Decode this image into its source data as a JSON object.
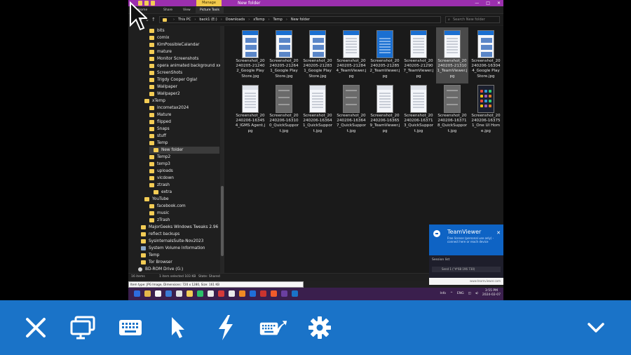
{
  "explorer": {
    "title_bar": {
      "manage_tab": "Manage",
      "window_title": "New folder",
      "controls": [
        "—",
        "□",
        "✕"
      ]
    },
    "ribbon_tabs": [
      {
        "label": "Home",
        "active": false
      },
      {
        "label": "Share",
        "active": false
      },
      {
        "label": "View",
        "active": false
      },
      {
        "label": "Picture Tools",
        "active": true
      }
    ],
    "address": {
      "breadcrumbs": [
        "This PC",
        "back1 (E:)",
        "Downloads",
        "xTemp",
        "Temp",
        "New folder"
      ],
      "search_placeholder": "Search New folder"
    },
    "nav_items": [
      {
        "label": "bits",
        "indent": 1,
        "kind": "folder"
      },
      {
        "label": "comix",
        "indent": 1,
        "kind": "folder"
      },
      {
        "label": "KimPossibleCalandar",
        "indent": 1,
        "kind": "folder"
      },
      {
        "label": "mature",
        "indent": 1,
        "kind": "folder"
      },
      {
        "label": "Monitor Screenshots",
        "indent": 1,
        "kind": "folder"
      },
      {
        "label": "opera animated background xxx",
        "indent": 1,
        "kind": "folder"
      },
      {
        "label": "ScreenShots",
        "indent": 1,
        "kind": "folder"
      },
      {
        "label": "Trigdy Cooper   Ogla!",
        "indent": 1,
        "kind": "folder"
      },
      {
        "label": "Wallpaper",
        "indent": 1,
        "kind": "folder"
      },
      {
        "label": "Wallpaper2",
        "indent": 1,
        "kind": "folder"
      },
      {
        "label": "xTemp",
        "indent": 0,
        "kind": "folder"
      },
      {
        "label": "incometax2024",
        "indent": 2,
        "kind": "folder"
      },
      {
        "label": "Mature",
        "indent": 2,
        "kind": "folder"
      },
      {
        "label": "flipped",
        "indent": 2,
        "kind": "folder"
      },
      {
        "label": "Snaps",
        "indent": 2,
        "kind": "folder"
      },
      {
        "label": "stuff",
        "indent": 2,
        "kind": "folder"
      },
      {
        "label": "Temp",
        "indent": 2,
        "kind": "folder"
      },
      {
        "label": "New folder",
        "indent": 3,
        "kind": "folder",
        "selected": true
      },
      {
        "label": "Temp2",
        "indent": 2,
        "kind": "folder"
      },
      {
        "label": "temp3",
        "indent": 2,
        "kind": "folder"
      },
      {
        "label": "uploads",
        "indent": 2,
        "kind": "folder"
      },
      {
        "label": "vlcdown",
        "indent": 2,
        "kind": "folder"
      },
      {
        "label": "ztrash",
        "indent": 2,
        "kind": "folder"
      },
      {
        "label": "extra",
        "indent": 3,
        "kind": "folder"
      },
      {
        "label": "YouTube",
        "indent": 0,
        "kind": "folder"
      },
      {
        "label": "facebook.com",
        "indent": 2,
        "kind": "folder"
      },
      {
        "label": "music",
        "indent": 2,
        "kind": "folder"
      },
      {
        "label": "zTrash",
        "indent": 2,
        "kind": "folder"
      },
      {
        "label": "MajorGeeks Windows Tweaks 2.96",
        "indent": -1,
        "kind": "folder"
      },
      {
        "label": "reflect backups",
        "indent": -1,
        "kind": "folder"
      },
      {
        "label": "SysinternalsSuite-Nov2023",
        "indent": -1,
        "kind": "folder"
      },
      {
        "label": "System Volume Information",
        "indent": -1,
        "kind": "sys"
      },
      {
        "label": "Temp",
        "indent": -1,
        "kind": "folder"
      },
      {
        "label": "Tor Browser",
        "indent": -1,
        "kind": "folder"
      },
      {
        "label": "BD-ROM Drive (G:)",
        "indent": -2,
        "kind": "drive"
      }
    ],
    "files": [
      {
        "name": "Screenshot_20240205-212402_Google Play Store.jpg",
        "style": "store",
        "selected": false
      },
      {
        "name": "Screenshot_20240205-212641_Google Play Store.jpg",
        "style": "store",
        "selected": false
      },
      {
        "name": "Screenshot_20240205-212831_Google Play Store.jpg",
        "style": "store",
        "selected": false
      },
      {
        "name": "Screenshot_20240205-212844_TeamViewer.jpg",
        "style": "tv",
        "selected": false
      },
      {
        "name": "Screenshot_20240205-212852_TeamViewer.jpg",
        "style": "tvblue",
        "selected": false
      },
      {
        "name": "Screenshot_20240205-212907_TeamViewer.jpg",
        "style": "tv",
        "selected": false
      },
      {
        "name": "Screenshot_20240205-213101_TeamViewer.jpg",
        "style": "tv",
        "selected": true
      },
      {
        "name": "Screenshot_20240206-163044_Google Play Store.jpg",
        "style": "store",
        "selected": false
      },
      {
        "name": "Screenshot_20240206-163454_IGMS Agent.jpg",
        "style": "doc",
        "selected": false
      },
      {
        "name": "Screenshot_20240206-163100_QuickSupport.jpg",
        "style": "gray",
        "selected": false
      },
      {
        "name": "Screenshot_20240206-163641_QuickSupport.jpg",
        "style": "doc",
        "selected": false
      },
      {
        "name": "Screenshot_20240206-163647_QuickSupport.jpg",
        "style": "gray",
        "selected": false
      },
      {
        "name": "Screenshot_20240206-163659_TeamViewer.jpg",
        "style": "doc",
        "selected": false
      },
      {
        "name": "Screenshot_20240206-163713_QuickSupport.jpg",
        "style": "doc",
        "selected": false
      },
      {
        "name": "Screenshot_20240206-163718_QuickSupport.jpg",
        "style": "gray",
        "selected": false
      },
      {
        "name": "Screenshot_20240206-163751_One UI Home.jpg",
        "style": "phone",
        "selected": false
      }
    ],
    "status": {
      "items": "16 items",
      "selected": "1 item selected  103 KB",
      "state": "State: Shared"
    },
    "tooltip": "Item type: JPG Image, Dimensions: 720 x 1280, Size: 161 KB"
  },
  "taskbar": {
    "lang": "ENG",
    "time": "3:55 PM",
    "date": "2024-02-07",
    "info": "Info"
  },
  "teamviewer": {
    "title": "TeamViewer",
    "body": "Free license (personal use only) - connect here or reach device",
    "session_label": "Session list",
    "session_row": "Send 1 (\"#'68 196 730)",
    "footer": "www.teamviewer.com",
    "accent": "#0e63c4"
  },
  "toolbar": {
    "background": "#1a73c8",
    "buttons": [
      {
        "name": "close-icon",
        "title": "Disconnect"
      },
      {
        "name": "monitor-icon",
        "title": "Switch monitor"
      },
      {
        "name": "keyboard-icon",
        "title": "Keyboard"
      },
      {
        "name": "pointer-icon",
        "title": "Mouse mode"
      },
      {
        "name": "lightning-icon",
        "title": "Actions"
      },
      {
        "name": "keyboard-arrow-icon",
        "title": "Special keys"
      },
      {
        "name": "gear-icon",
        "title": "Settings"
      },
      {
        "name": "chevron-down-icon",
        "title": "Hide toolbar"
      }
    ]
  }
}
